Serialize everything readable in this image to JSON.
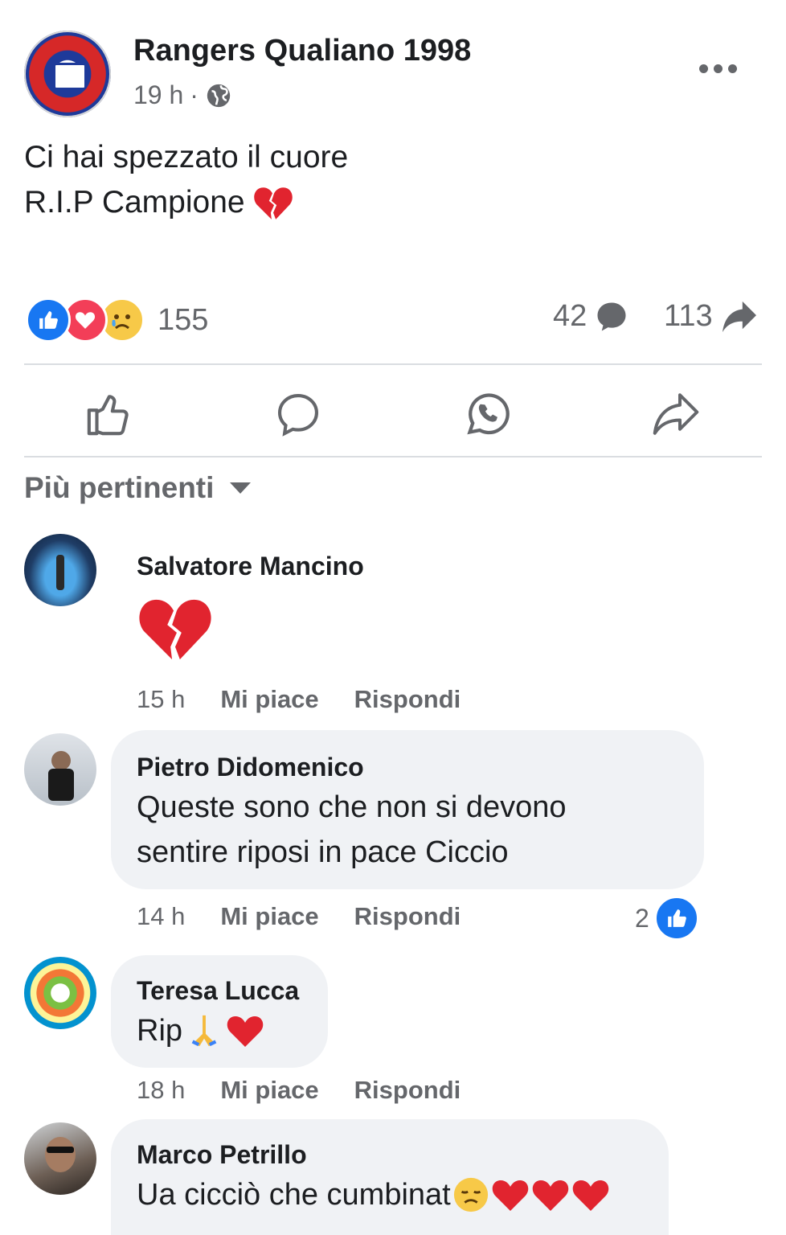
{
  "post": {
    "page_name": "Rangers Qualiano 1998",
    "time": "19 h",
    "separator": "·",
    "audience_icon": "globe-icon",
    "text_line1": "Ci hai spezzato il cuore",
    "text_line2": "R.I.P Campione",
    "text_emoji": "broken-heart"
  },
  "stats": {
    "reactions": [
      "like",
      "love",
      "sad"
    ],
    "reaction_count": "155",
    "comment_count": "42",
    "share_count": "113"
  },
  "actions": [
    "like-icon",
    "comment-icon",
    "whatsapp-icon",
    "share-icon"
  ],
  "sort": {
    "label": "Più pertinenti"
  },
  "colors": {
    "like_blue": "#1877f2",
    "love_red": "#f33e58",
    "text_gray": "#65676b",
    "bubble": "#f0f2f5"
  },
  "comments": [
    {
      "author": "Salvatore Mancino",
      "text": "",
      "emoji": "broken-heart",
      "time": "15 h",
      "like": "Mi piace",
      "reply": "Rispondi"
    },
    {
      "author": "Pietro Didomenico",
      "text_line1": "Queste sono che non si devono",
      "text_line2": "sentire riposi in pace Ciccio",
      "time": "14 h",
      "like": "Mi piace",
      "reply": "Rispondi",
      "likes": "2"
    },
    {
      "author": "Teresa Lucca",
      "text": "Rip",
      "emoji": "pray, red-heart",
      "time": "18 h",
      "like": "Mi piace",
      "reply": "Rispondi"
    },
    {
      "author": "Marco Petrillo",
      "text": "Ua cicciò che cumbinat",
      "emoji": "disappointed-face, red-heart, red-heart, red-heart"
    }
  ]
}
